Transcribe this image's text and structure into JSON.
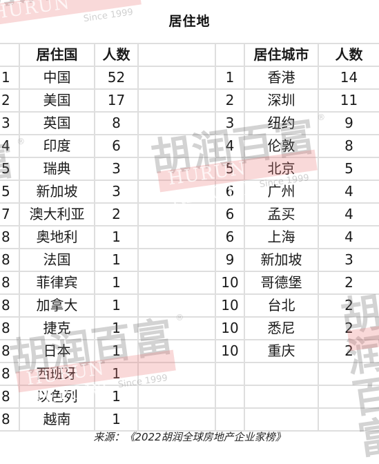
{
  "title": "居住地",
  "country_table": {
    "headers": [
      "",
      "居住国",
      "人数"
    ],
    "rows": [
      {
        "rank": "1",
        "name": "中国",
        "count": "52"
      },
      {
        "rank": "2",
        "name": "美国",
        "count": "17"
      },
      {
        "rank": "3",
        "name": "英国",
        "count": "8"
      },
      {
        "rank": "4",
        "name": "印度",
        "count": "6"
      },
      {
        "rank": "5",
        "name": "瑞典",
        "count": "3"
      },
      {
        "rank": "5",
        "name": "新加坡",
        "count": "3"
      },
      {
        "rank": "7",
        "name": "澳大利亚",
        "count": "2"
      },
      {
        "rank": "8",
        "name": "奥地利",
        "count": "1"
      },
      {
        "rank": "8",
        "name": "法国",
        "count": "1"
      },
      {
        "rank": "8",
        "name": "菲律宾",
        "count": "1"
      },
      {
        "rank": "8",
        "name": "加拿大",
        "count": "1"
      },
      {
        "rank": "8",
        "name": "捷克",
        "count": "1"
      },
      {
        "rank": "8",
        "name": "日本",
        "count": "1"
      },
      {
        "rank": "8",
        "name": "西班牙",
        "count": "1"
      },
      {
        "rank": "8",
        "name": "以色列",
        "count": "1"
      },
      {
        "rank": "8",
        "name": "越南",
        "count": "1"
      }
    ]
  },
  "city_table": {
    "headers": [
      "",
      "居住城市",
      "人数"
    ],
    "rows": [
      {
        "rank": "1",
        "name": "香港",
        "count": "14"
      },
      {
        "rank": "2",
        "name": "深圳",
        "count": "11"
      },
      {
        "rank": "3",
        "name": "纽约",
        "count": "9"
      },
      {
        "rank": "4",
        "name": "伦敦",
        "count": "8"
      },
      {
        "rank": "5",
        "name": "北京",
        "count": "5"
      },
      {
        "rank": "6",
        "name": "广州",
        "count": "4"
      },
      {
        "rank": "6",
        "name": "孟买",
        "count": "4"
      },
      {
        "rank": "6",
        "name": "上海",
        "count": "4"
      },
      {
        "rank": "9",
        "name": "新加坡",
        "count": "3"
      },
      {
        "rank": "10",
        "name": "哥德堡",
        "count": "2"
      },
      {
        "rank": "10",
        "name": "台北",
        "count": "2"
      },
      {
        "rank": "10",
        "name": "悉尼",
        "count": "2"
      },
      {
        "rank": "10",
        "name": "重庆",
        "count": "2"
      }
    ]
  },
  "footer": "来源：《2022胡润全球房地产企业家榜》",
  "watermark": {
    "cn": "胡润百富",
    "en": "HURUN REPORT",
    "since": "Since 1999",
    "reg": "®"
  }
}
